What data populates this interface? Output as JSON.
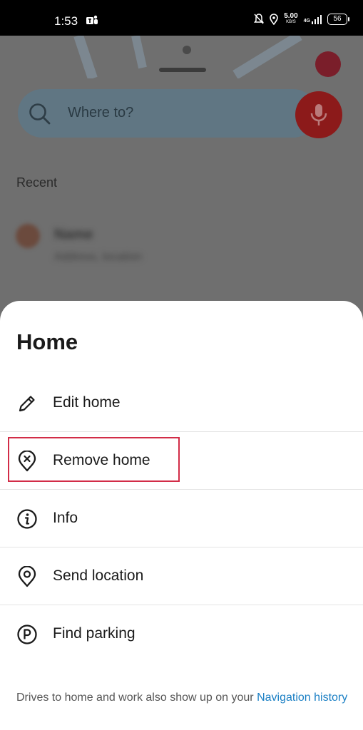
{
  "status_bar": {
    "time": "1:53",
    "speed_value": "5.00",
    "speed_unit": "KB/S",
    "network": "4G",
    "battery": "56"
  },
  "search": {
    "placeholder": "Where to?"
  },
  "recent": {
    "label": "Recent",
    "item_name": "Name",
    "item_address": "Address, location"
  },
  "sheet": {
    "title": "Home",
    "items": [
      {
        "label": "Edit home",
        "icon": "pencil-icon"
      },
      {
        "label": "Remove home",
        "icon": "remove-pin-icon"
      },
      {
        "label": "Info",
        "icon": "info-icon"
      },
      {
        "label": "Send location",
        "icon": "location-pin-icon"
      },
      {
        "label": "Find parking",
        "icon": "parking-icon"
      }
    ],
    "footer_text": "Drives to home and work also show up on your ",
    "footer_link": "Navigation history"
  },
  "colors": {
    "highlight": "#d22c47",
    "link": "#1a7fc4",
    "mic": "#8c1a1a"
  }
}
